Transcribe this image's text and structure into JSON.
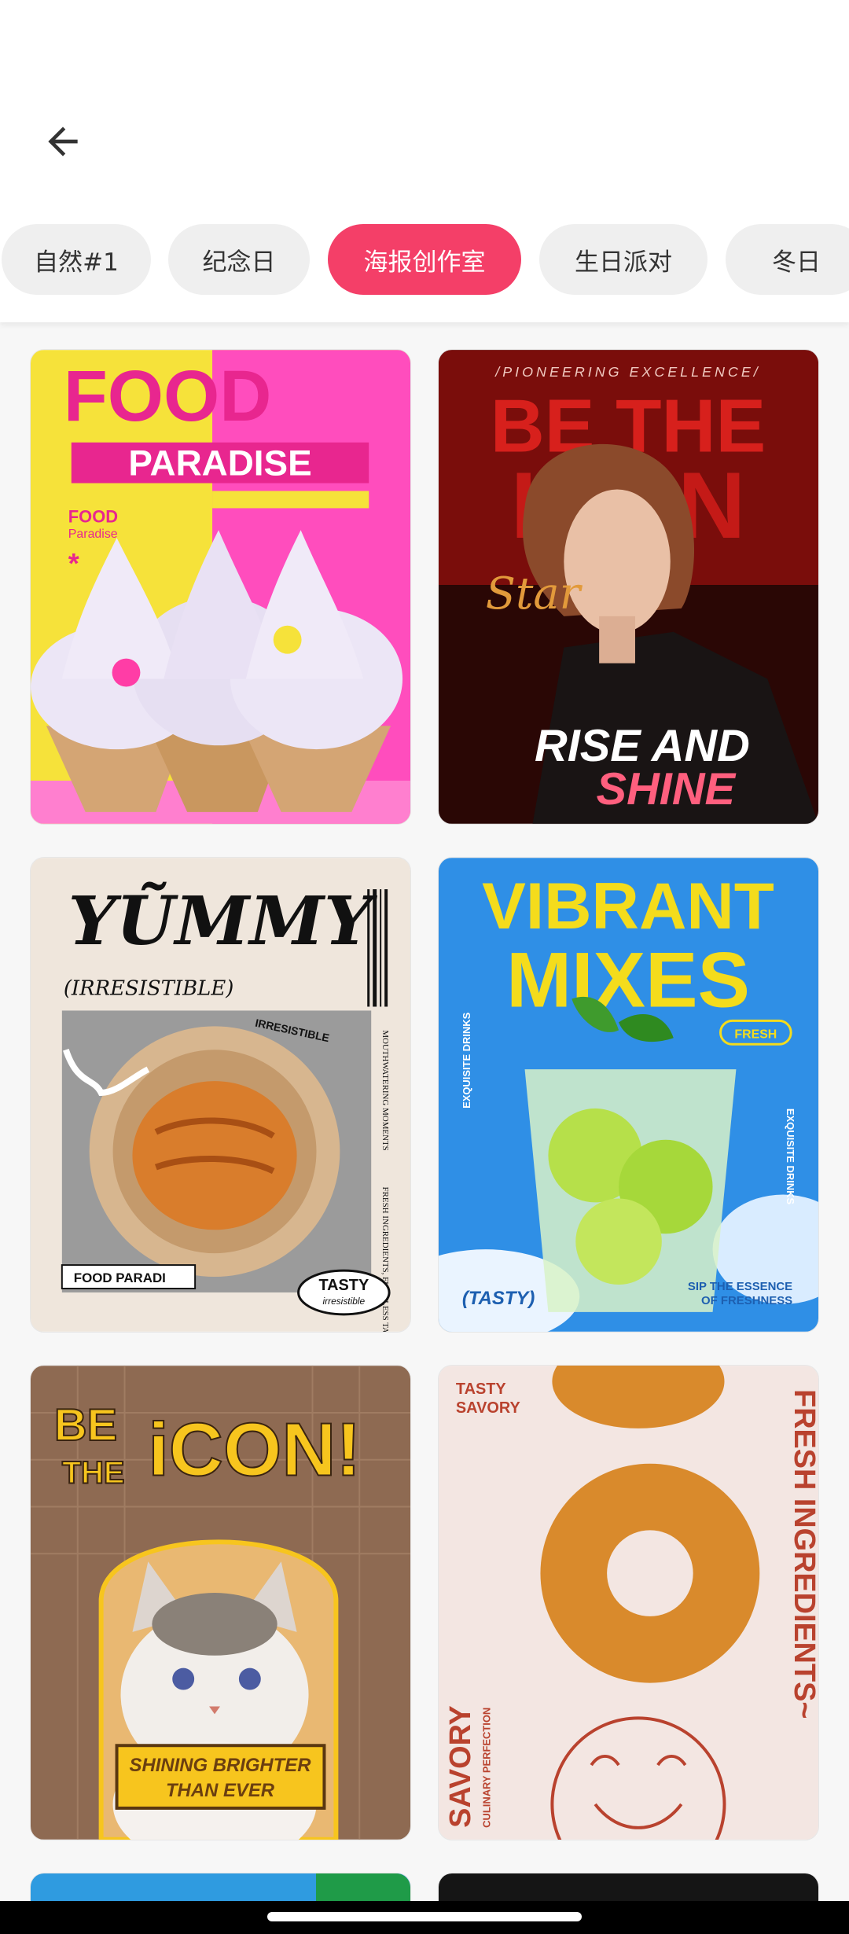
{
  "nav": {
    "back_icon": "arrow-left-icon"
  },
  "categories": [
    {
      "label": "自然#1",
      "active": false
    },
    {
      "label": "纪念日",
      "active": false
    },
    {
      "label": "海报创作室",
      "active": true
    },
    {
      "label": "生日派对",
      "active": false
    },
    {
      "label": "冬日",
      "active": false
    }
  ],
  "colors": {
    "accent": "#f43f68",
    "chip_bg": "#efefef"
  },
  "templates": [
    {
      "line1": "FOOD",
      "line2": "PARADISE",
      "badge": "FOOD",
      "badge2": "Paradise"
    },
    {
      "tagline": "/PIONEERING EXCELLENCE/",
      "headline1": "BE THE",
      "headline2": "ICON",
      "script": "Star",
      "footer1": "RISE AND",
      "footer2": "SHINE"
    },
    {
      "headline": "YŨMMY",
      "subline": "(IRRESISTIBLE)",
      "tag": "IRRESISTIBLE",
      "side1": "MOUTHWATERING MOMENTS",
      "side2": "FRESH INGREDIENTS, FLAWLESS TASTE.",
      "footer": "FOOD PARADI",
      "stamp1": "TASTY",
      "stamp2": "irresistible"
    },
    {
      "headline1": "VIBRANT",
      "headline2": "MIXES",
      "badge": "FRESH",
      "left": "EXQUISITE DRINKS",
      "right": "EXQUISITE DRINKS",
      "footer_left": "(TASTY)",
      "footer_right1": "SIP THE ESSENCE",
      "footer_right2": "OF FRESHNESS"
    },
    {
      "headline1": "BE",
      "headline2": "THE",
      "headline3": "iCON!",
      "banner1": "SHINING BRIGHTER",
      "banner2": "THAN EVER"
    },
    {
      "corner1": "TASTY",
      "corner2": "SAVORY",
      "side": "FRESH INGREDIENTS~",
      "left": "SAVORY",
      "left_small": "CULINARY PERFECTION"
    }
  ]
}
